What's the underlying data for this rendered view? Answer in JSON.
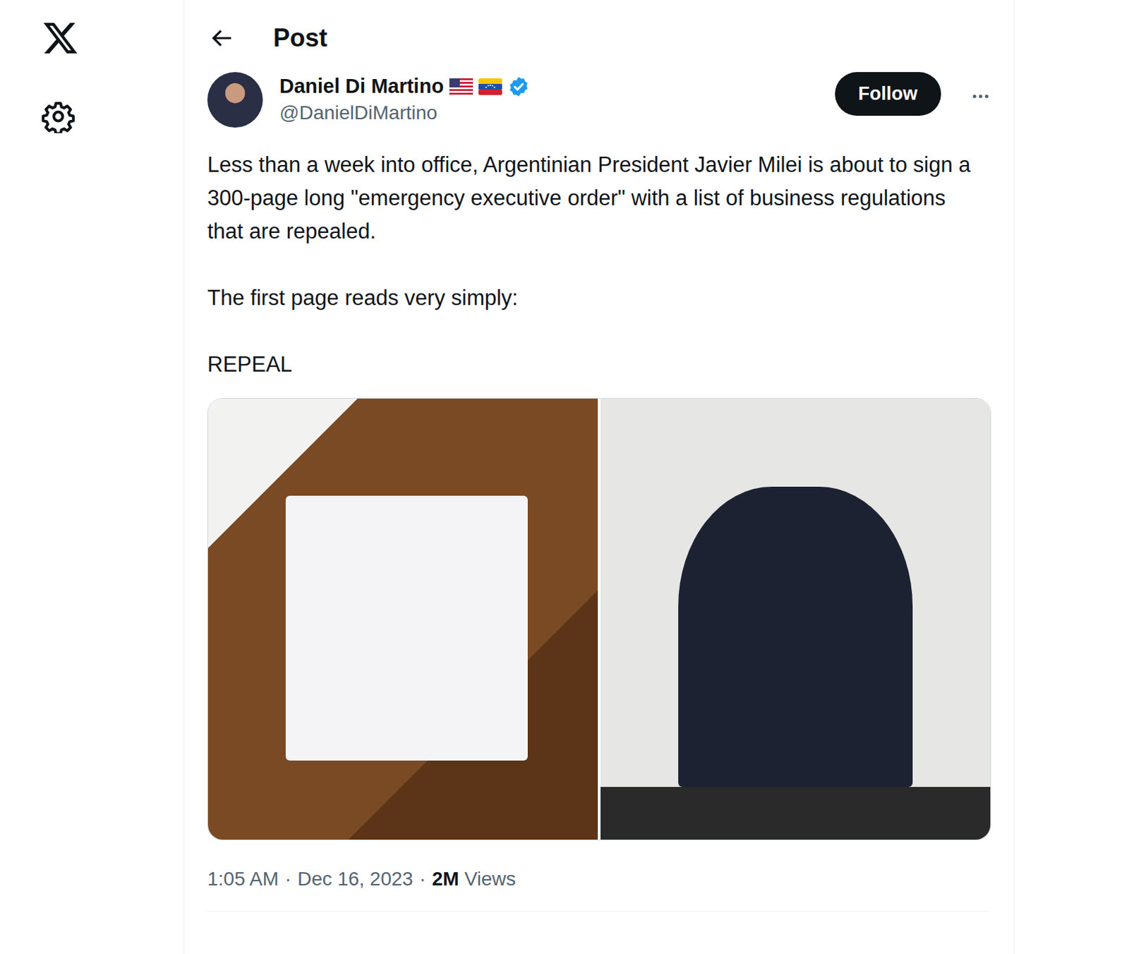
{
  "header": {
    "title": "Post"
  },
  "post": {
    "author": {
      "name": "Daniel Di Martino",
      "handle": "@DanielDiMartino"
    },
    "follow_button": "Follow",
    "paragraphs": [
      "Less than a week into office, Argentinian President Javier Milei is about to sign a 300-page long \"emergency executive order\" with a list of business regulations that are repealed.",
      "The first page reads very simply:",
      "REPEAL"
    ],
    "meta": {
      "time": "1:05 AM",
      "separator": "·",
      "date": "Dec 16, 2023",
      "views_count": "2M",
      "views_label": "Views"
    }
  }
}
